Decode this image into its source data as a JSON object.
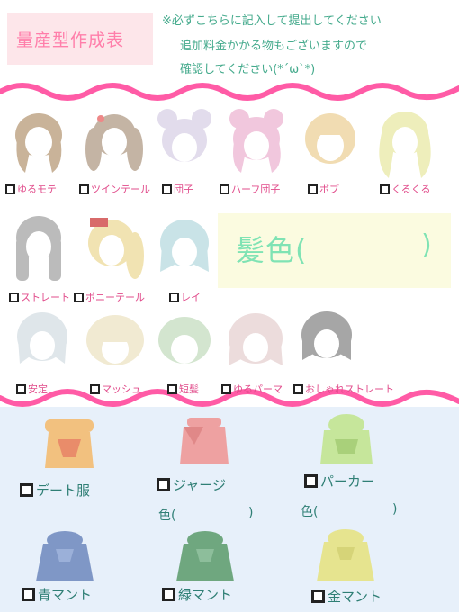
{
  "title": "量産型作成表",
  "notes": [
    "※必ずこちらに記入して提出してください",
    "追加料金かかる物もございますので",
    "確認してください(*´ω`*)"
  ],
  "hair_options": [
    {
      "label": "ゆるモテ",
      "color": "#c9b399"
    },
    {
      "label": "ツインテール",
      "color": "#c4b4a4"
    },
    {
      "label": "団子",
      "color": "#e2dcec"
    },
    {
      "label": "ハーフ団子",
      "color": "#f1c7dd"
    },
    {
      "label": "ボブ",
      "color": "#f1dcb2"
    },
    {
      "label": "くるくる",
      "color": "#eeeebb"
    },
    {
      "label": "ストレート",
      "color": "#bbbbbb"
    },
    {
      "label": "ポニーテール",
      "color": "#f1e3b2"
    },
    {
      "label": "レイ",
      "color": "#c9e3e7"
    },
    {
      "label": "安定",
      "color": "#dfe6ea"
    },
    {
      "label": "マッシュ",
      "color": "#f1ead2"
    },
    {
      "label": "短髪",
      "color": "#d3e5cf"
    },
    {
      "label": "ゆるパーマ",
      "color": "#ecdcdc"
    },
    {
      "label": "おしゃれストレート",
      "color": "#a6a6a6"
    }
  ],
  "hair_color": {
    "label": "髪色(",
    "close": ")"
  },
  "costume_options": [
    {
      "label": "デート服",
      "color": "#f2c17f"
    },
    {
      "label": "ジャージ",
      "color": "#eea1a1",
      "sub_open": "色(",
      "sub_close": ")"
    },
    {
      "label": "パーカー",
      "color": "#c6e69b",
      "sub_open": "色(",
      "sub_close": ")"
    },
    {
      "label": "青マント",
      "color": "#7f97c6"
    },
    {
      "label": "緑マント",
      "color": "#6fa77f"
    },
    {
      "label": "金マント",
      "color": "#e6e48f"
    }
  ]
}
